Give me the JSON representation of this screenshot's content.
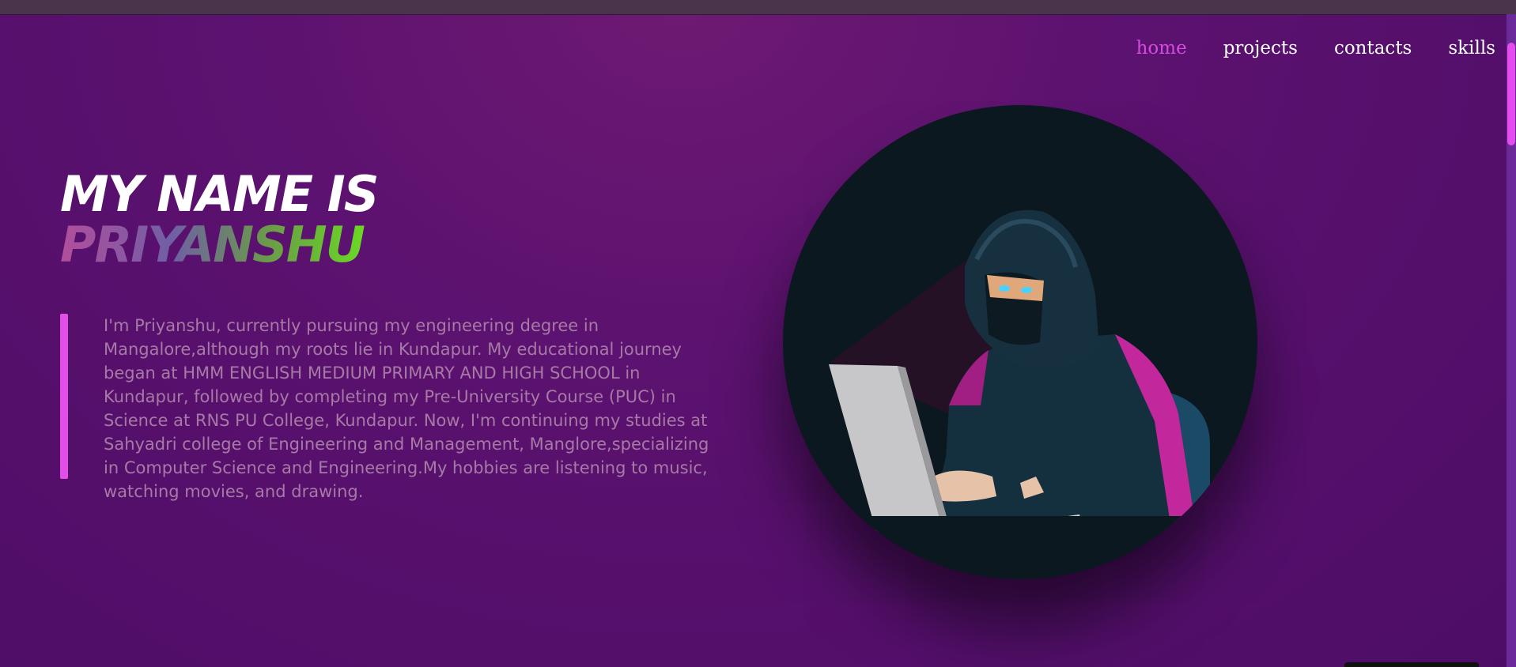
{
  "nav": {
    "items": [
      {
        "label": "home",
        "active": true
      },
      {
        "label": "projects",
        "active": false
      },
      {
        "label": "contacts",
        "active": false
      },
      {
        "label": "skills",
        "active": false
      }
    ]
  },
  "hero": {
    "line1": "MY NAME IS",
    "line2": "PRIYANSHU",
    "about": "I'm Priyanshu, currently pursuing my engineering degree in Mangalore,although my roots lie in Kundapur. My educational journey began at HMM ENGLISH MEDIUM PRIMARY AND HIGH SCHOOL in Kundapur, followed by completing my Pre-University Course (PUC) in Science at RNS PU College, Kundapur. Now, I'm continuing my studies at Sahyadri college of Engineering and Management, Manglore,specializing in Computer Science and Engineering.My hobbies are listening to music, watching movies, and drawing."
  },
  "colors": {
    "accent": "#e24fe8",
    "nav_active": "#d44bde",
    "background": "#5a1170"
  },
  "icons": {
    "profile": "hooded-hacker-illustration"
  }
}
